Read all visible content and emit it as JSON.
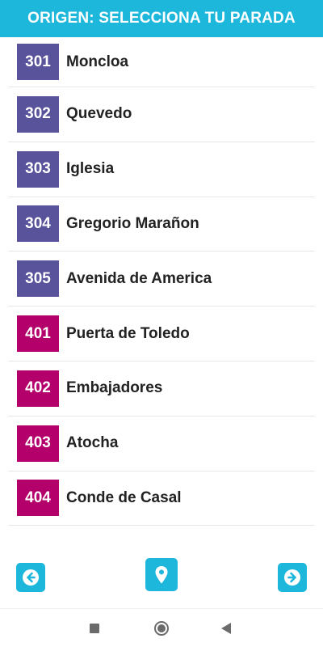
{
  "header": {
    "title": "ORIGEN: SELECCIONA TU PARADA"
  },
  "colors": {
    "accent": "#1cb7db",
    "line3": "#59539b",
    "line4": "#b3006b"
  },
  "stops": [
    {
      "code": "301",
      "name": "Moncloa",
      "color": "#59539b"
    },
    {
      "code": "302",
      "name": "Quevedo",
      "color": "#59539b"
    },
    {
      "code": "303",
      "name": "Iglesia",
      "color": "#59539b"
    },
    {
      "code": "304",
      "name": "Gregorio Marañon",
      "color": "#59539b"
    },
    {
      "code": "305",
      "name": "Avenida de America",
      "color": "#59539b"
    },
    {
      "code": "401",
      "name": "Puerta de Toledo",
      "color": "#b3006b"
    },
    {
      "code": "402",
      "name": "Embajadores",
      "color": "#b3006b"
    },
    {
      "code": "403",
      "name": "Atocha",
      "color": "#b3006b"
    },
    {
      "code": "404",
      "name": "Conde de Casal",
      "color": "#b3006b"
    }
  ],
  "nav": {
    "prev_icon": "arrow-left-circle-icon",
    "location_icon": "map-pin-icon",
    "next_icon": "arrow-right-circle-icon"
  },
  "system_bar": {
    "icons": [
      "recents-square-icon",
      "home-circle-icon",
      "back-triangle-icon"
    ]
  }
}
